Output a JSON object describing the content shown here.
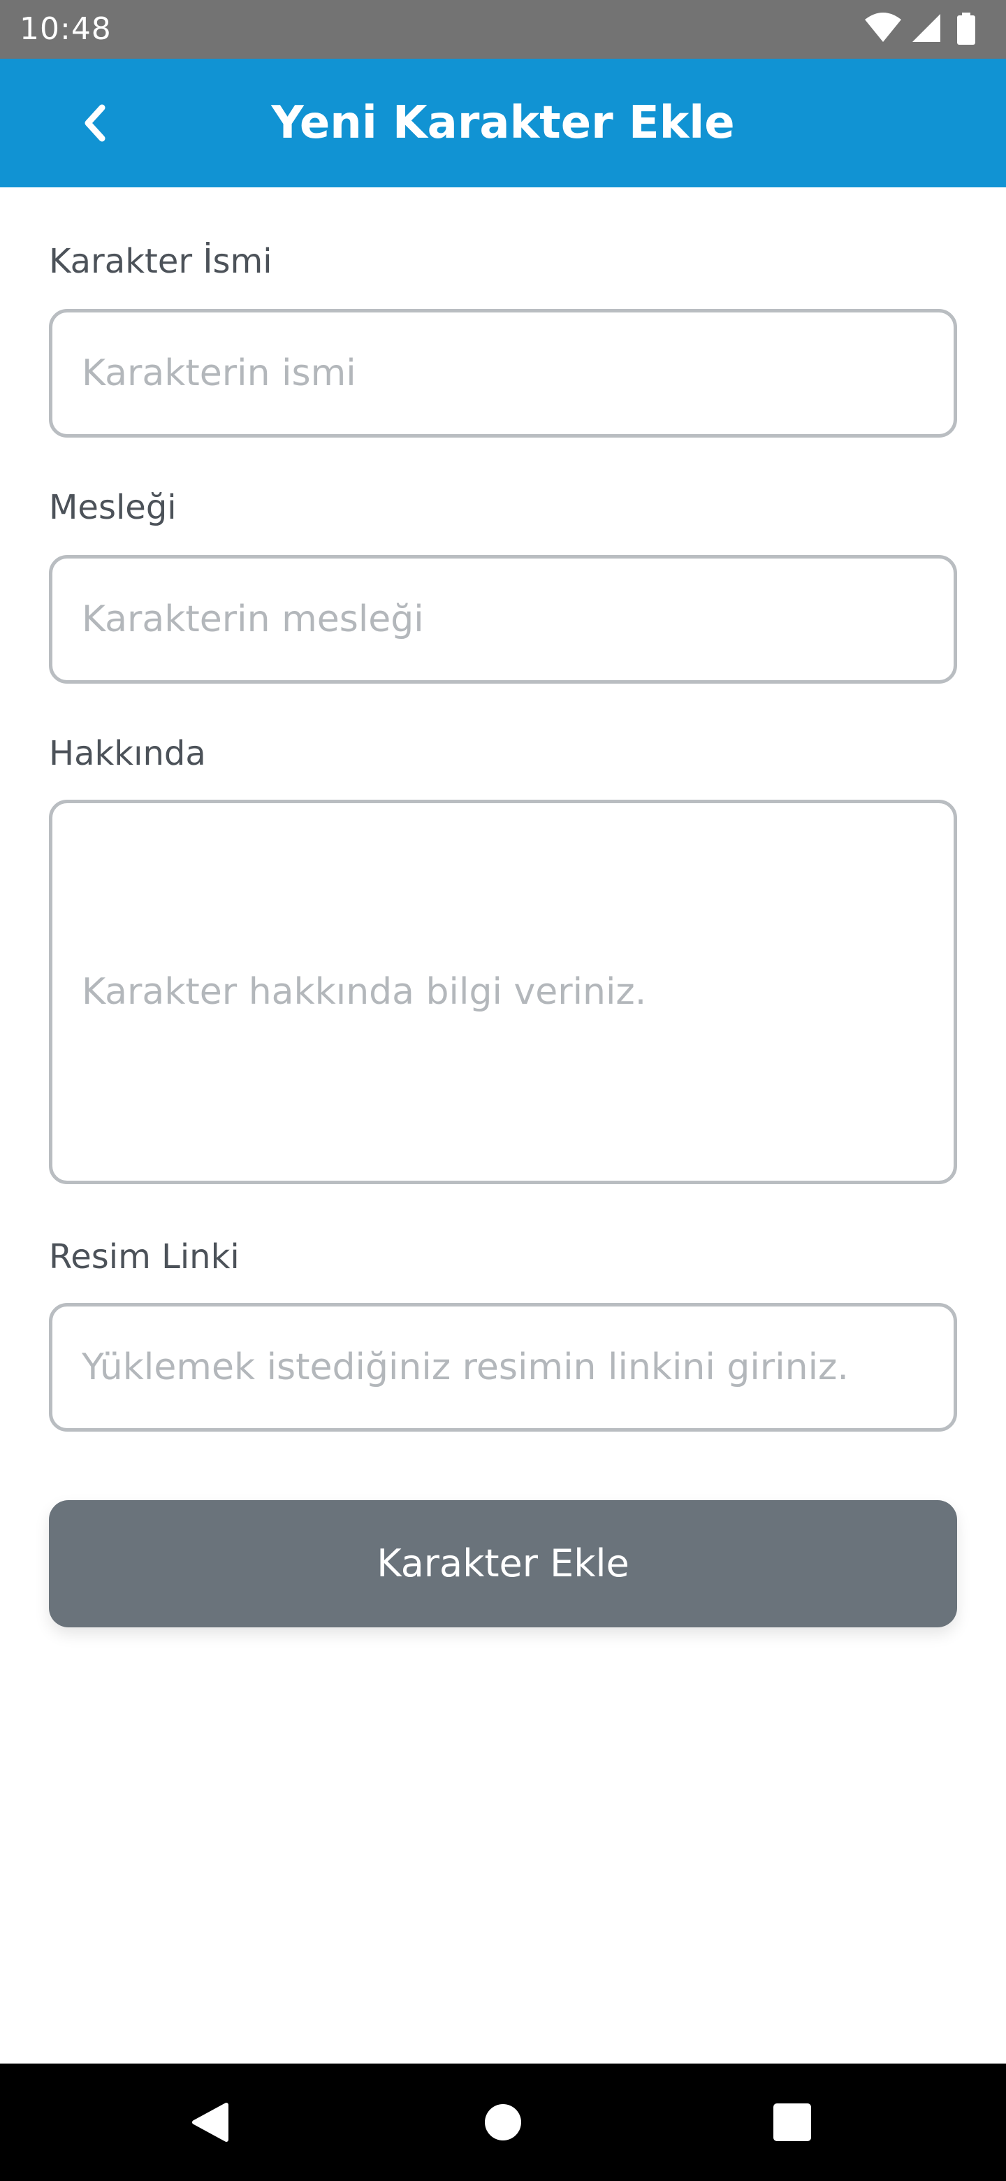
{
  "status_bar": {
    "time": "10:48",
    "icons": [
      "wifi-icon",
      "signal-icon",
      "battery-icon"
    ]
  },
  "app_bar": {
    "title": "Yeni Karakter Ekle",
    "back_icon": "chevron-left-icon",
    "color": "#1193d3"
  },
  "form": {
    "name": {
      "label": "Karakter İsmi",
      "placeholder": "Karakterin ismi",
      "value": ""
    },
    "job": {
      "label": "Mesleği",
      "placeholder": "Karakterin mesleği",
      "value": ""
    },
    "about": {
      "label": "Hakkında",
      "placeholder": "Karakter hakkında bilgi veriniz.",
      "value": ""
    },
    "image": {
      "label": "Resim Linki",
      "placeholder": "Yüklemek istediğiniz resimin linkini giriniz.",
      "value": ""
    },
    "submit_label": "Karakter Ekle",
    "submit_color": "#6a737b"
  },
  "nav_bar": {
    "icons": [
      "back-triangle-icon",
      "home-circle-icon",
      "recents-square-icon"
    ]
  }
}
